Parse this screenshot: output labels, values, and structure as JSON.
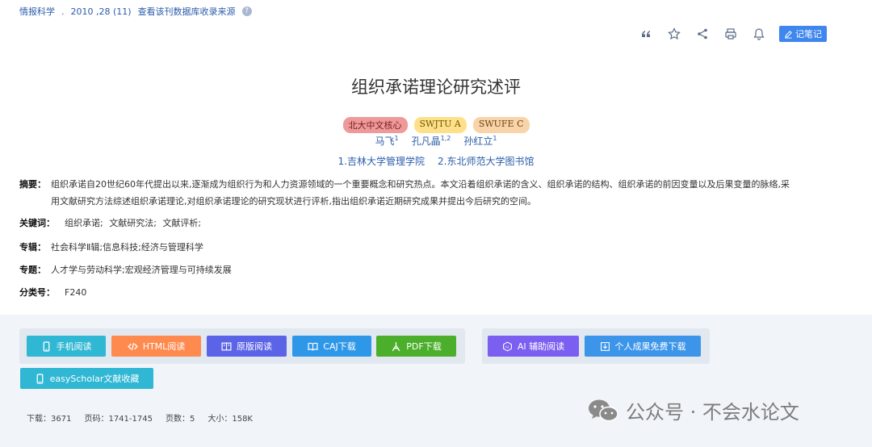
{
  "source": {
    "journal": "情报科学",
    "issue": "2010 ,28 (11)",
    "link": "查看该刊数据库收录来源"
  },
  "toolbar": {
    "items": [
      {
        "name": "quote-icon"
      },
      {
        "name": "star-icon"
      },
      {
        "name": "share-icon"
      },
      {
        "name": "print-icon"
      },
      {
        "name": "bell-icon"
      }
    ],
    "note_label": "记笔记"
  },
  "title": "组织承诺理论研究述评",
  "badges": [
    "北大中文核心",
    "SWJTU A",
    "SWUFE C"
  ],
  "authors": [
    {
      "name": "马飞",
      "sup": "1"
    },
    {
      "name": "孔凡晶",
      "sup": "1,2"
    },
    {
      "name": "孙红立",
      "sup": "1"
    }
  ],
  "affiliations": [
    "1.吉林大学管理学院",
    "2.东北师范大学图书馆"
  ],
  "abstract": {
    "label": "摘要：",
    "line1": "组织承诺自20世纪60年代提出以来,逐渐成为组织行为和人力资源领域的一个重要概念和研究热点。本文沿着组织承诺的含义、组织承诺的结构、组织承诺的前因变量以及后果变量的脉络,采",
    "line2": "用文献研究方法综述组织承诺理论,对组织承诺理论的研究现状进行评析,指出组织承诺近期研究成果并提出今后研究的空间。"
  },
  "keywords": {
    "label": "关键词：",
    "items": [
      "组织承诺;",
      "文献研究法;",
      "文献评析;"
    ]
  },
  "series": {
    "label": "专辑：",
    "value": "社会科学Ⅱ辑;信息科技;经济与管理科学"
  },
  "topic": {
    "label": "专题：",
    "value": "人才学与劳动科学;宏观经济管理与可持续发展"
  },
  "classification": {
    "label": "分类号：",
    "value": "F240"
  },
  "buttons": {
    "mobile": "手机阅读",
    "html": "HTML阅读",
    "original": "原版阅读",
    "caj": "CAJ下载",
    "pdf": "PDF下载",
    "ai": "AI 辅助阅读",
    "personal": "个人成果免费下载",
    "easyscholar": "easyScholar文献收藏"
  },
  "colors": {
    "mobile": "#2fb7d3",
    "html": "#ff8a4f",
    "original": "#5b64e6",
    "caj": "#2f97e8",
    "pdf": "#4caf2c",
    "ai": "#7a5ff0",
    "personal": "#3d95ea",
    "easyscholar": "#2fb7d3"
  },
  "stats": {
    "downloads_label": "下载：",
    "downloads": "3671",
    "pages_label": "页码：",
    "pages": "1741-1745",
    "page_count_label": "页数：",
    "page_count": "5",
    "size_label": "大小：",
    "size": "158K"
  },
  "watermark": "公众号 · 不会水论文"
}
